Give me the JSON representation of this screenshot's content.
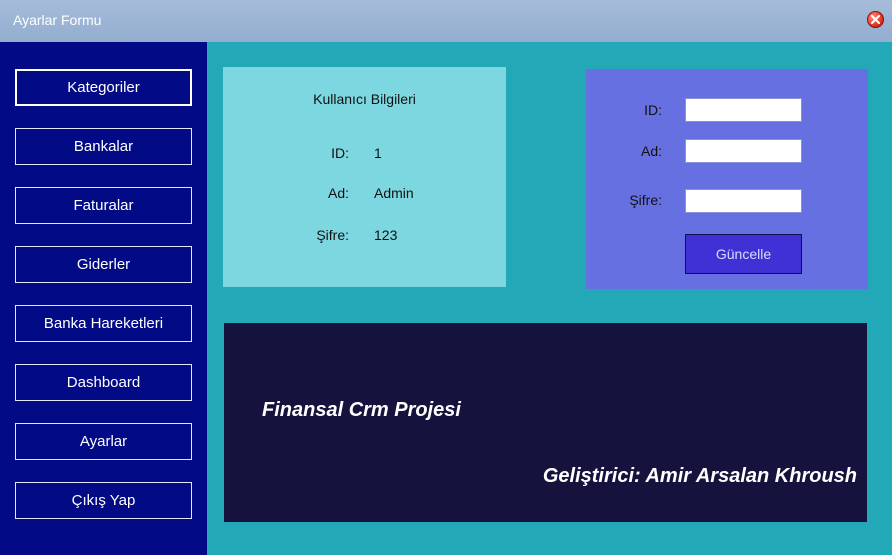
{
  "window": {
    "title": "Ayarlar Formu"
  },
  "sidebar": {
    "items": [
      {
        "label": "Kategoriler"
      },
      {
        "label": "Bankalar"
      },
      {
        "label": "Faturalar"
      },
      {
        "label": "Giderler"
      },
      {
        "label": "Banka Hareketleri"
      },
      {
        "label": "Dashboard"
      },
      {
        "label": "Ayarlar"
      },
      {
        "label": "Çıkış Yap"
      }
    ]
  },
  "user_info": {
    "title": "Kullanıcı Bilgileri",
    "id_label": "ID:",
    "id_value": "1",
    "name_label": "Ad:",
    "name_value": "Admin",
    "password_label": "Şifre:",
    "password_value": "123"
  },
  "edit_form": {
    "id_label": "ID:",
    "id_value": "",
    "name_label": "Ad:",
    "name_value": "",
    "password_label": "Şifre:",
    "password_value": "",
    "update_label": "Güncelle"
  },
  "banner": {
    "project_title": "Finansal Crm Projesi",
    "developer": "Geliştirici: Amir Arsalan Khroush"
  },
  "colors": {
    "background": "#22a8b6",
    "sidebar": "#030a86",
    "user_panel": "#7dd7e0",
    "edit_panel": "#6770e1",
    "banner": "#15123e",
    "update_button": "#3f31d6"
  }
}
